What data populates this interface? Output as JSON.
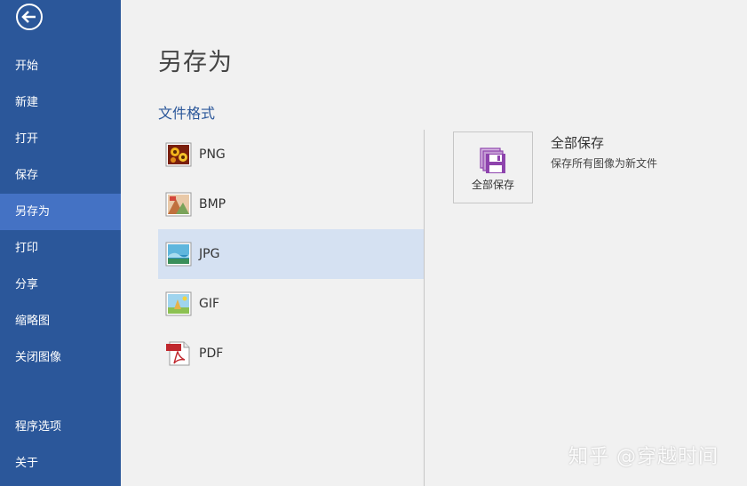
{
  "sidebar": {
    "back_icon": "back-arrow-icon",
    "items": [
      {
        "label": "开始"
      },
      {
        "label": "新建"
      },
      {
        "label": "打开"
      },
      {
        "label": "保存"
      },
      {
        "label": "另存为",
        "active": true
      },
      {
        "label": "打印"
      },
      {
        "label": "分享"
      },
      {
        "label": "缩略图"
      },
      {
        "label": "关闭图像"
      },
      {
        "label": "程序选项"
      },
      {
        "label": "关于"
      }
    ]
  },
  "main": {
    "title": "另存为",
    "section_title": "文件格式",
    "formats": [
      {
        "label": "PNG",
        "icon": "png-icon"
      },
      {
        "label": "BMP",
        "icon": "bmp-icon"
      },
      {
        "label": "JPG",
        "icon": "jpg-icon",
        "selected": true
      },
      {
        "label": "GIF",
        "icon": "gif-icon"
      },
      {
        "label": "PDF",
        "icon": "pdf-icon"
      }
    ],
    "save_all": {
      "tile_label": "全部保存",
      "title": "全部保存",
      "description": "保存所有图像为新文件",
      "icon": "save-all-icon"
    }
  },
  "watermark": "知乎 @穿越时间",
  "colors": {
    "sidebar_bg": "#2b579a",
    "sidebar_active": "#4472c4",
    "selected_row": "#d5e1f2",
    "accent": "#2b579a",
    "save_icon": "#8e44ad"
  }
}
